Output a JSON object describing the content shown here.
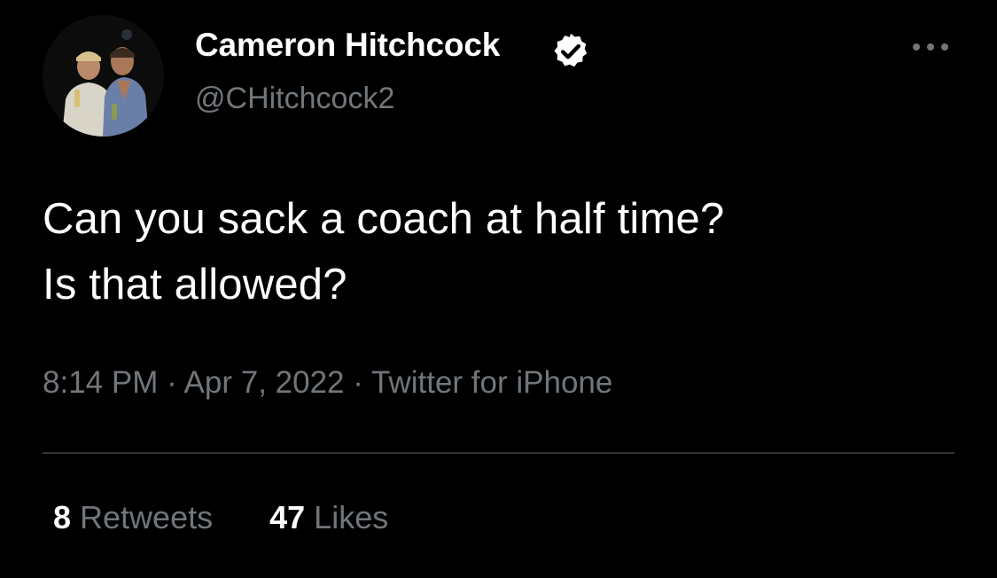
{
  "user": {
    "display_name": "Cameron Hitchcock",
    "handle": "@CHitchcock2",
    "verified": true
  },
  "tweet": {
    "lines": [
      "Can you sack a coach at half time?",
      "Is that allowed?"
    ]
  },
  "meta": {
    "time": "8:14 PM",
    "separator": "·",
    "date": "Apr 7, 2022",
    "source": "Twitter for iPhone"
  },
  "stats": {
    "retweets_count": "8",
    "retweets_label": "Retweets",
    "likes_count": "47",
    "likes_label": "Likes"
  },
  "icons": {
    "verified": "verified-badge-icon",
    "more": "more-options-icon"
  },
  "colors": {
    "background": "#000000",
    "primary_text": "#ffffff",
    "secondary_text": "#71767b",
    "divider": "#2f3336"
  }
}
